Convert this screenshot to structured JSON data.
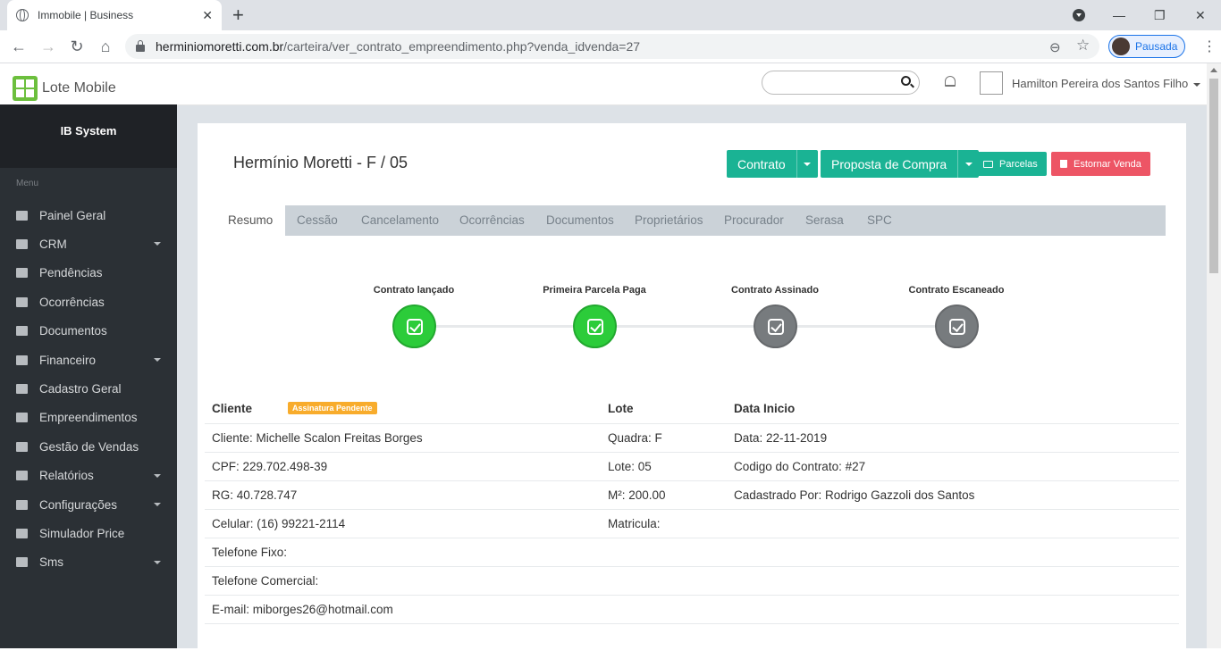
{
  "browser": {
    "tab_title": "Immobile | Business",
    "url_domain": "herminiomoretti.com.br",
    "url_path": "/carteira/ver_contrato_empreendimento.php?venda_idvenda=27",
    "profile_label": "Pausada"
  },
  "header": {
    "logo_text": "Lote Mobile",
    "search_placeholder": "",
    "user_name": "Hamilton Pereira dos Santos Filho"
  },
  "sidebar": {
    "brand": "IB System",
    "menu_label": "Menu",
    "items": [
      {
        "label": "Painel Geral",
        "icon": "dashboard-icon",
        "has_arrow": false
      },
      {
        "label": "CRM",
        "icon": "list-icon",
        "has_arrow": true
      },
      {
        "label": "Pendências",
        "icon": "files-icon",
        "has_arrow": false
      },
      {
        "label": "Ocorrências",
        "icon": "warning-icon",
        "has_arrow": false
      },
      {
        "label": "Documentos",
        "icon": "pdf-icon",
        "has_arrow": false
      },
      {
        "label": "Financeiro",
        "icon": "money-icon",
        "has_arrow": true
      },
      {
        "label": "Cadastro Geral",
        "icon": "users-icon",
        "has_arrow": false
      },
      {
        "label": "Empreendimentos",
        "icon": "building-icon",
        "has_arrow": false
      },
      {
        "label": "Gestão de Vendas",
        "icon": "list-icon",
        "has_arrow": false
      },
      {
        "label": "Relatórios",
        "icon": "pdf-icon",
        "has_arrow": true
      },
      {
        "label": "Configurações",
        "icon": "gear-icon",
        "has_arrow": true
      },
      {
        "label": "Simulador Price",
        "icon": "calculator-icon",
        "has_arrow": false
      },
      {
        "label": "Sms",
        "icon": "message-icon",
        "has_arrow": true
      }
    ]
  },
  "page": {
    "title": "Hermínio Moretti - F / 05",
    "buttons": {
      "contrato": "Contrato",
      "proposta": "Proposta de Compra",
      "parcelas": "Parcelas",
      "estornar": "Estornar Venda"
    },
    "colors": {
      "primary": "#1ab394",
      "danger": "#ed5565",
      "done": "#2ccc3a",
      "pending": "#777b7e",
      "badge": "#f8ac2c"
    },
    "tabs": [
      "Resumo",
      "Cessão",
      "Cancelamento",
      "Ocorrências",
      "Documentos",
      "Proprietários",
      "Procurador",
      "Serasa",
      "SPC"
    ],
    "active_tab": "Resumo",
    "steps": [
      {
        "label": "Contrato lançado",
        "status": "done"
      },
      {
        "label": "Primeira Parcela Paga",
        "status": "done"
      },
      {
        "label": "Contrato Assinado",
        "status": "pending"
      },
      {
        "label": "Contrato Escaneado",
        "status": "pending"
      }
    ],
    "table": {
      "headers": [
        "Cliente",
        "Lote",
        "Data Inicio"
      ],
      "badge": "Assinatura Pendente",
      "rows": [
        [
          "Cliente: Michelle Scalon Freitas Borges",
          "Quadra: F",
          "Data: 22-11-2019"
        ],
        [
          "CPF: 229.702.498-39",
          "Lote: 05",
          "Codigo do Contrato: #27"
        ],
        [
          "RG: 40.728.747",
          "M²: 200.00",
          "Cadastrado Por: Rodrigo Gazzoli dos Santos"
        ],
        [
          "Celular: (16) 99221-2114",
          "Matricula:",
          ""
        ],
        [
          "Telefone Fixo:",
          "",
          ""
        ],
        [
          "Telefone Comercial:",
          "",
          ""
        ],
        [
          "E-mail: miborges26@hotmail.com",
          "",
          ""
        ]
      ]
    }
  }
}
